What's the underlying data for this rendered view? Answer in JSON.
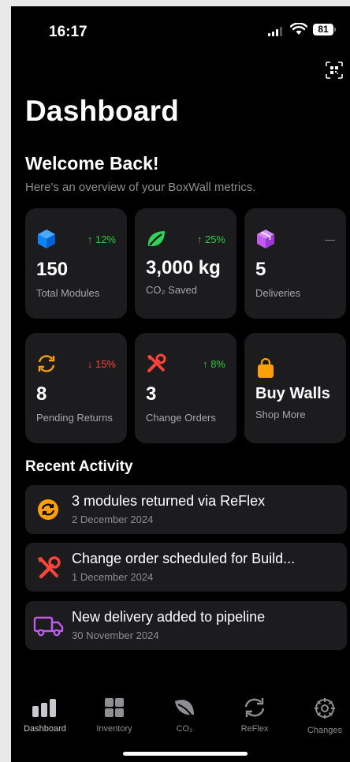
{
  "status_bar": {
    "time": "16:17",
    "battery": "81"
  },
  "header": {
    "title": "Dashboard",
    "welcome": "Welcome Back!",
    "subtitle": "Here's an overview of your BoxWall metrics."
  },
  "stats": [
    {
      "icon": "cube-icon",
      "color": "#0a84ff",
      "delta": "↑ 12%",
      "value": "150",
      "label": "Total Modules"
    },
    {
      "icon": "leaf-icon",
      "color": "#30d158",
      "delta": "↑ 25%",
      "value": "3,000 kg",
      "label": "CO₂ Saved"
    },
    {
      "icon": "package-icon",
      "color": "#bf5af2",
      "delta": "—",
      "value": "5",
      "label": "Deliveries"
    },
    {
      "icon": "return-arrows-icon",
      "color": "#ff9f0a",
      "delta": "↓ 15%",
      "value": "8",
      "label": "Pending Returns"
    },
    {
      "icon": "tools-icon",
      "color": "#ff453a",
      "delta": "↑ 8%",
      "value": "3",
      "label": "Change Orders"
    },
    {
      "icon": "shopping-bag-icon",
      "color": "#ff9f0a",
      "delta": "",
      "value": "Buy Walls",
      "label": "Shop More"
    }
  ],
  "recent_activity": {
    "heading": "Recent Activity",
    "items": [
      {
        "icon": "return-circle-icon",
        "title": "3 modules returned via ReFlex",
        "date": "2 December 2024"
      },
      {
        "icon": "tools-icon",
        "title": "Change order scheduled for Build...",
        "date": "1 December 2024"
      },
      {
        "icon": "truck-icon",
        "title": "New delivery added to pipeline",
        "date": "30 November 2024"
      }
    ]
  },
  "tabs": [
    {
      "label": "Dashboard",
      "icon": "bar-chart-icon"
    },
    {
      "label": "Inventory",
      "icon": "grid-icon"
    },
    {
      "label": "CO₂",
      "icon": "leaf-icon"
    },
    {
      "label": "ReFlex",
      "icon": "refresh-icon"
    },
    {
      "label": "Changes",
      "icon": "gear-icon"
    }
  ]
}
